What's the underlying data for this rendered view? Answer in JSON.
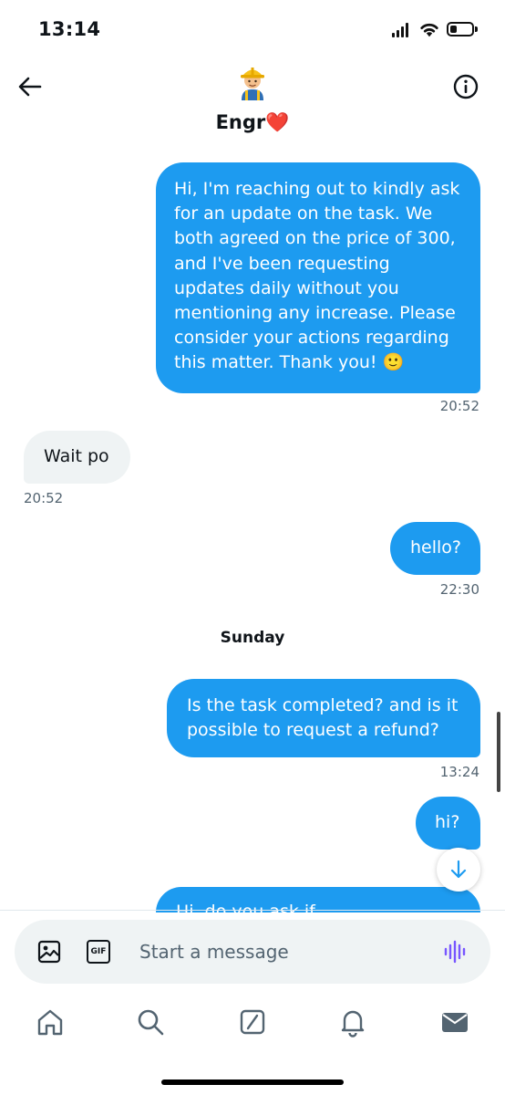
{
  "status_bar": {
    "time": "13:14"
  },
  "header": {
    "title": "Engr❤️"
  },
  "messages": [
    {
      "from": "me",
      "text": "Hi, I'm reaching out to kindly ask for an update on the task. We both agreed on the price of 300, and I've been requesting updates daily without you mentioning any increase. Please consider your actions regarding this matter. Thank you! 🙂",
      "time": "20:52"
    },
    {
      "from": "them",
      "text": "Wait po",
      "time": "20:52"
    },
    {
      "from": "me",
      "text": "hello?",
      "time": "22:30"
    },
    {
      "from": "me",
      "text": "Is the task completed? and is it possible to request a refund?",
      "time": "13:24"
    },
    {
      "from": "me",
      "text": "hi?"
    },
    {
      "from": "me",
      "text": "Hi, do you ask if..."
    }
  ],
  "day_separator": "Sunday",
  "composer": {
    "placeholder": "Start a message",
    "gif_label": "GIF"
  },
  "tabs": [
    "home",
    "search",
    "grok",
    "notifications",
    "messages"
  ],
  "colors": {
    "accent": "#1d9bf0",
    "received_bubble": "#eff3f4",
    "timestamp": "#536471",
    "voice": "#7856ff"
  }
}
